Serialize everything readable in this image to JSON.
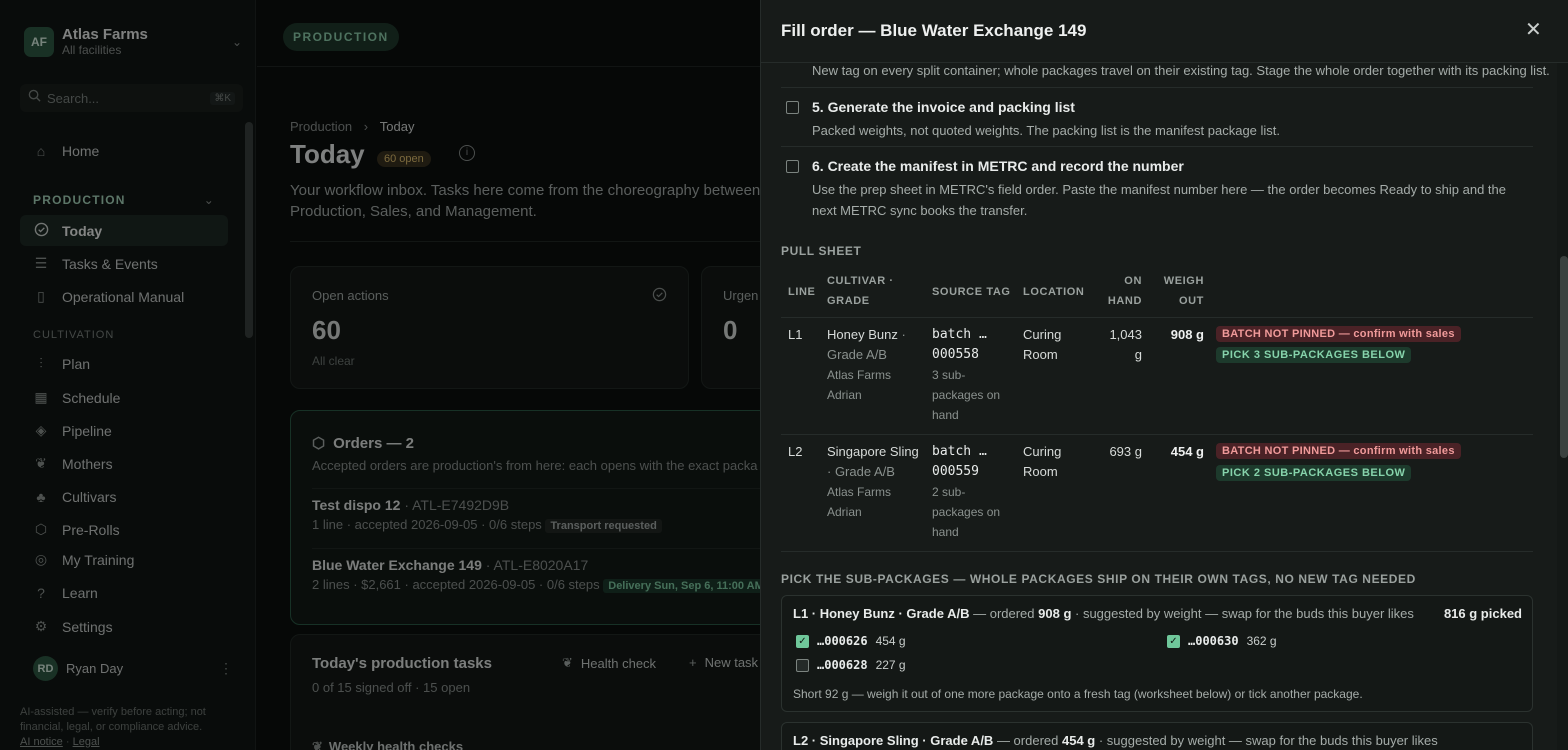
{
  "sidebar": {
    "org_initials": "AF",
    "org_name": "Atlas Farms",
    "org_sub": "All facilities",
    "search_placeholder": "Search...",
    "search_kbd": "⌘K",
    "home": "Home",
    "production_header": "PRODUCTION",
    "production_items": [
      "Today",
      "Tasks & Events",
      "Operational Manual"
    ],
    "cultivation_header": "CULTIVATION",
    "cultivation_items": [
      "Plan",
      "Schedule",
      "Pipeline",
      "Mothers",
      "Cultivars",
      "Pre-Rolls"
    ],
    "bottom_items": [
      "My Training",
      "Learn",
      "Settings"
    ],
    "user_initials": "RD",
    "user_name": "Ryan Day",
    "disclaimer": "AI-assisted — verify before acting; not financial, legal, or compliance advice.",
    "ai_notice": "AI notice",
    "legal": "Legal"
  },
  "main": {
    "pill": "PRODUCTION",
    "crumb_parent": "Production",
    "crumb_current": "Today",
    "title": "Today",
    "open_badge": "60 open",
    "description": "Your workflow inbox. Tasks here come from the choreography between Production, Sales, and Management.",
    "open_actions_label": "Open actions",
    "open_actions_value": "60",
    "open_actions_sub": "All clear",
    "urgent_label": "Urgen",
    "urgent_value": "0",
    "orders_title": "Orders — 2",
    "orders_desc": "Accepted orders are production's from here: each opens with the exact packa",
    "orders": [
      {
        "name": "Test dispo 12",
        "ref": "· ATL-E7492D9B",
        "meta": "1 line · accepted 2026-09-05 · 0/6 steps",
        "tag": "Transport requested"
      },
      {
        "name": "Blue Water Exchange 149",
        "ref": "· ATL-E8020A17",
        "meta": "2 lines · $2,661 · accepted 2026-09-05 · 0/6 steps",
        "tag": "Delivery Sun, Sep 6, 11:00 AM"
      }
    ],
    "tasks_title": "Today's production tasks",
    "tasks_sub": "0 of 15 signed off · 15 open",
    "health_check": "Health check",
    "new_task": "New task",
    "weekly": "Weekly health checks"
  },
  "drawer": {
    "title": "Fill order — Blue Water Exchange 149",
    "step4_cont": "New tag on every split container; whole packages travel on their existing tag. Stage the whole order together with its packing list.",
    "steps": [
      {
        "title": "5. Generate the invoice and packing list",
        "desc": "Packed weights, not quoted weights. The packing list is the manifest package list."
      },
      {
        "title": "6. Create the manifest in METRC and record the number",
        "desc": "Use the prep sheet in METRC's field order. Paste the manifest number here — the order becomes Ready to ship and the next METRC sync books the transfer."
      }
    ],
    "pull_sheet_label": "PULL SHEET",
    "pull_headers": {
      "line": "LINE",
      "cultivar": "CULTIVAR · GRADE",
      "source": "SOURCE TAG",
      "location": "LOCATION",
      "on_hand": "ON HAND",
      "weigh_out": "WEIGH OUT"
    },
    "pull_rows": [
      {
        "line": "L1",
        "cultivar": "Honey Bunz",
        "grade": "· Grade A/B",
        "farm": "Atlas Farms",
        "person": "Adrian",
        "tag1": "batch …",
        "tag2": "000558",
        "subpk": "3 sub-packages on hand",
        "location": "Curing Room",
        "on_hand": "1,043 g",
        "weigh_out": "908 g",
        "badge_red": "BATCH NOT PINNED — confirm with sales",
        "badge_green": "PICK 3 SUB-PACKAGES BELOW"
      },
      {
        "line": "L2",
        "cultivar": "Singapore Sling",
        "grade": "· Grade A/B",
        "farm": "Atlas Farms",
        "person": "Adrian",
        "tag1": "batch …",
        "tag2": "000559",
        "subpk": "2 sub-packages on hand",
        "location": "Curing Room",
        "on_hand": "693 g",
        "weigh_out": "454 g",
        "badge_red": "BATCH NOT PINNED — confirm with sales",
        "badge_green": "PICK 2 SUB-PACKAGES BELOW"
      }
    ],
    "pick_label": "PICK THE SUB-PACKAGES — WHOLE PACKAGES SHIP ON THEIR OWN TAGS, NO NEW TAG NEEDED",
    "picks": [
      {
        "head": "L1 · Honey Bunz · Grade A/B",
        "ordered_prefix": " — ordered ",
        "ordered": "908 g",
        "hint": " · suggested by weight — swap for the buds this buyer likes",
        "picked": "816 g picked",
        "packages": [
          {
            "tag": "…000626",
            "weight": "454 g",
            "checked": true
          },
          {
            "tag": "…000630",
            "weight": "362 g",
            "checked": true
          },
          {
            "tag": "…000628",
            "weight": "227 g",
            "checked": false
          }
        ],
        "note": "Short 92 g — weigh it out of one more package onto a fresh tag (worksheet below) or tick another package."
      },
      {
        "head": "L2 · Singapore Sling · Grade A/B",
        "ordered_prefix": " — ordered ",
        "ordered": "454 g",
        "hint": " · suggested by weight — swap for the buds this buyer likes"
      }
    ]
  }
}
